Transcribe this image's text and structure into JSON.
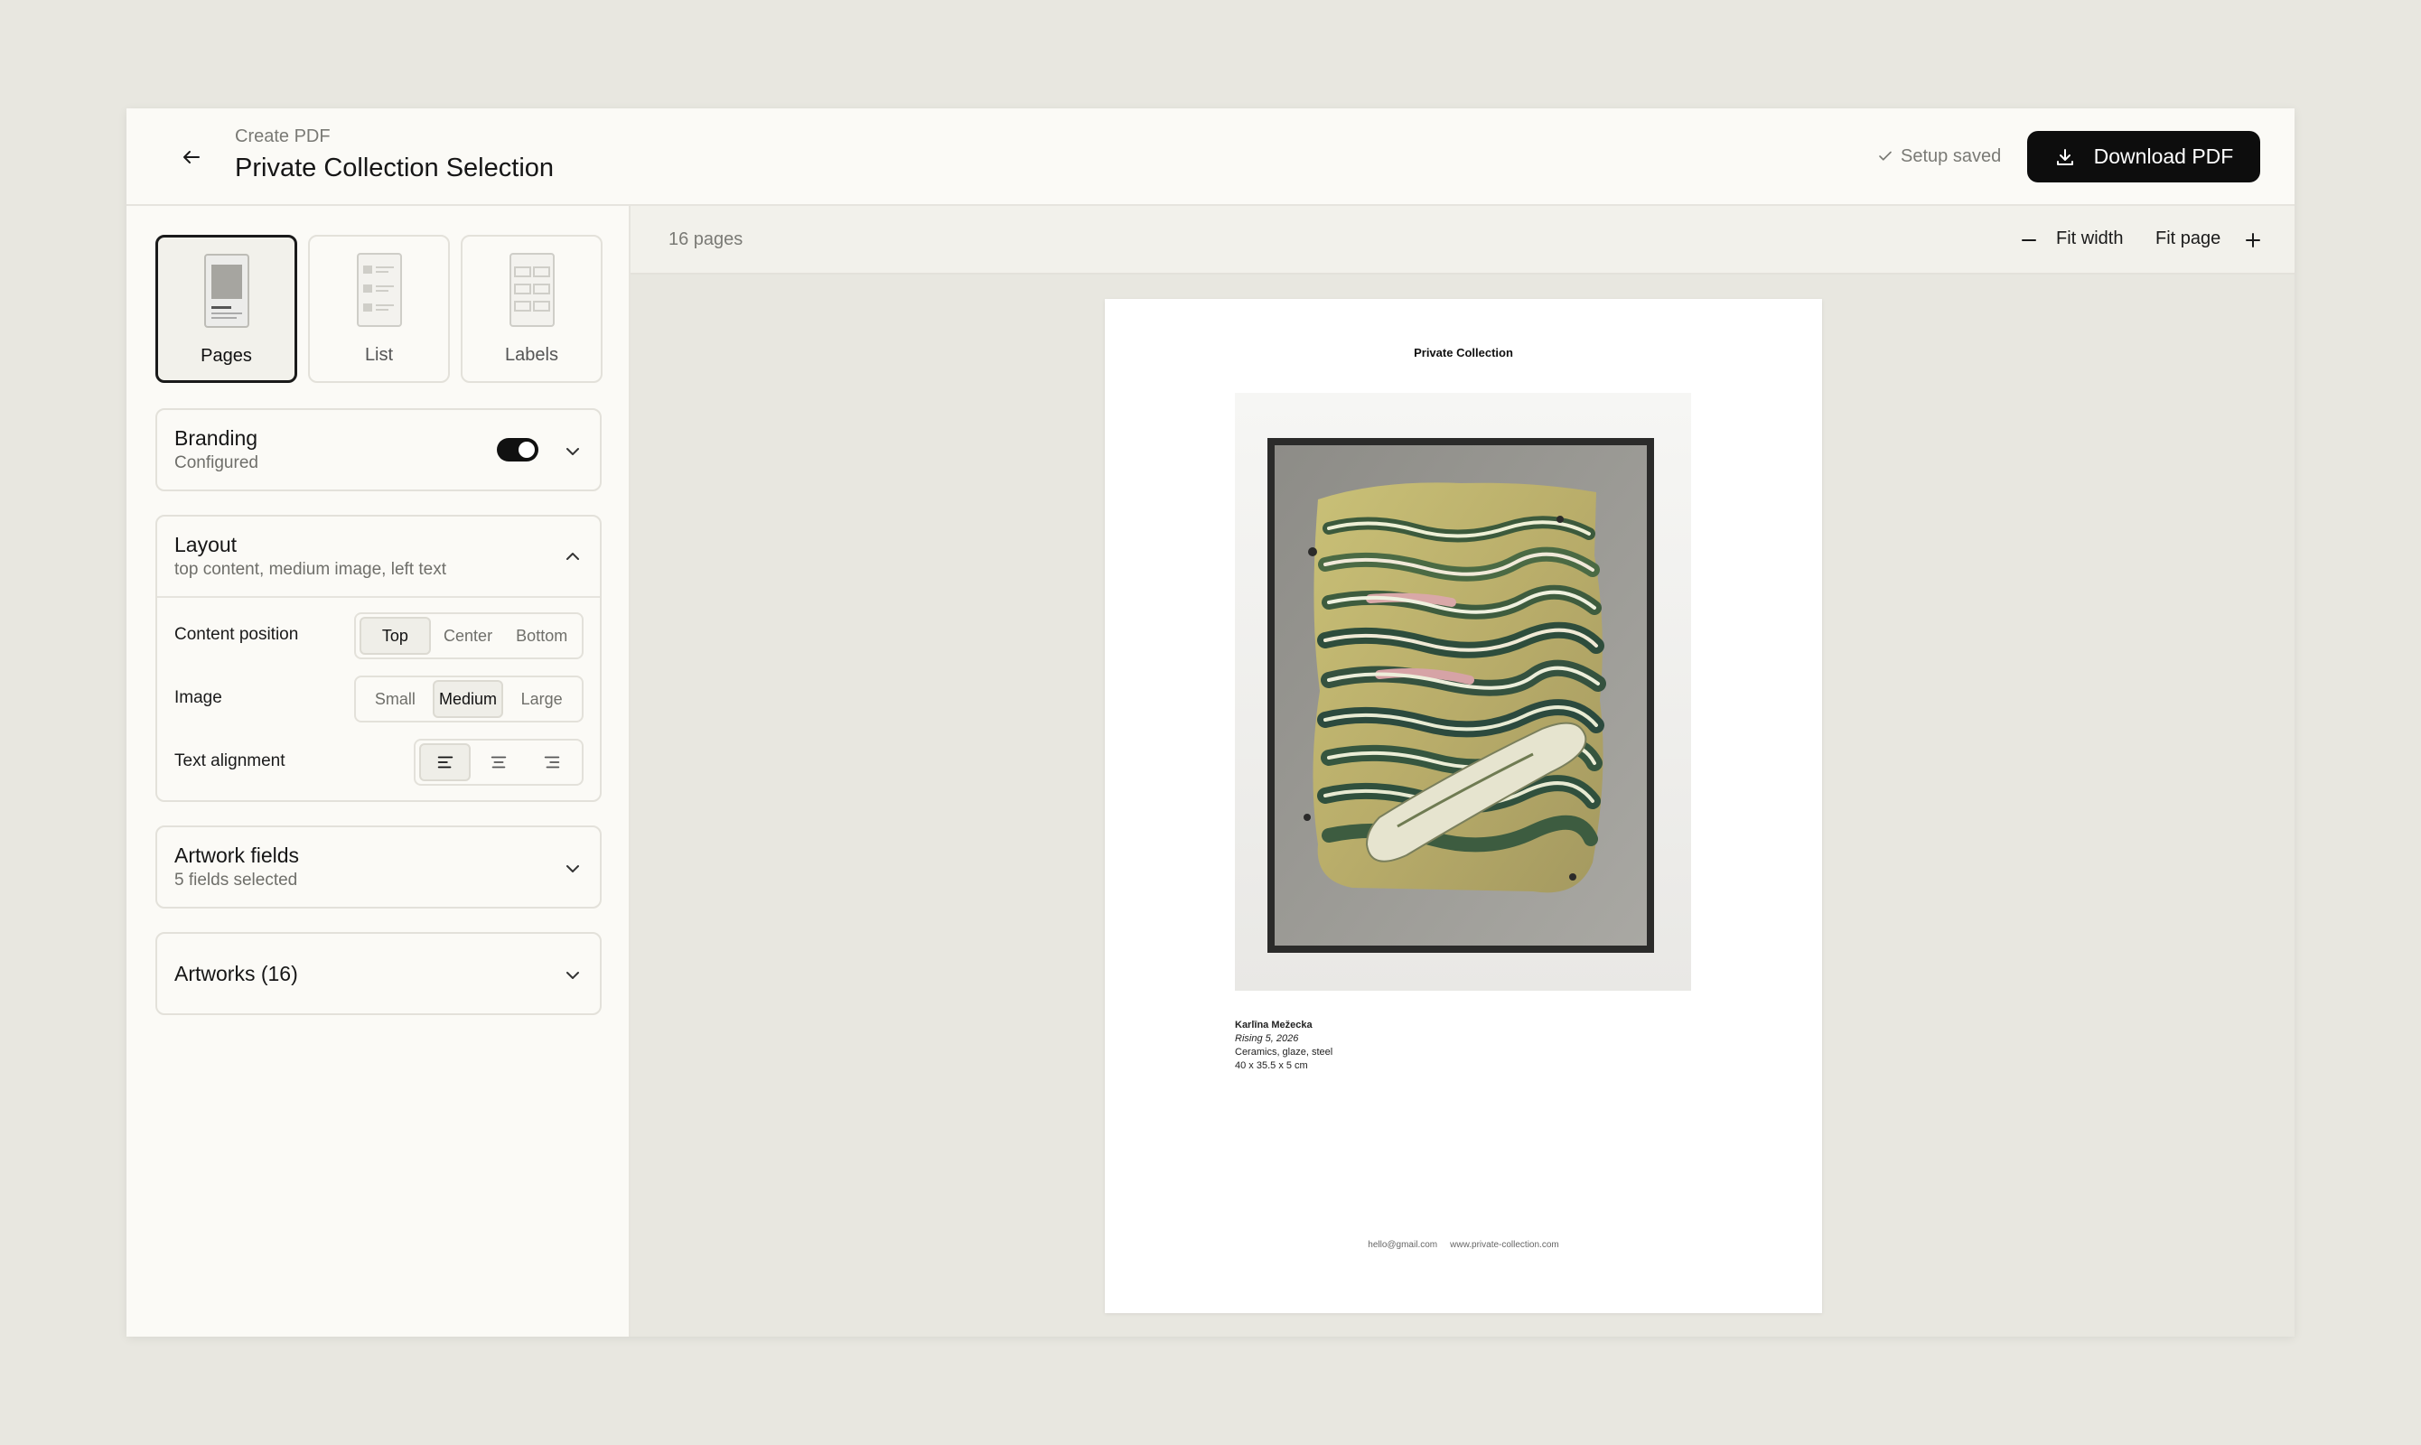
{
  "header": {
    "breadcrumb": "Create PDF",
    "title": "Private Collection Selection",
    "status": "Setup saved",
    "download_label": "Download PDF"
  },
  "modes": [
    {
      "label": "Pages",
      "active": true
    },
    {
      "label": "List",
      "active": false
    },
    {
      "label": "Labels",
      "active": false
    }
  ],
  "branding": {
    "title": "Branding",
    "subtitle": "Configured",
    "enabled": true
  },
  "layout": {
    "title": "Layout",
    "subtitle": "top content, medium image, left text",
    "content_position": {
      "label": "Content position",
      "options": [
        "Top",
        "Center",
        "Bottom"
      ],
      "selected": "Top"
    },
    "image": {
      "label": "Image",
      "options": [
        "Small",
        "Medium",
        "Large"
      ],
      "selected": "Medium"
    },
    "text_alignment": {
      "label": "Text alignment",
      "options": [
        "align-left-icon",
        "align-center-icon",
        "align-right-icon"
      ],
      "selected": "align-left-icon"
    }
  },
  "artwork_fields": {
    "title": "Artwork fields",
    "subtitle": "5 fields selected"
  },
  "artworks": {
    "title": "Artworks (16)"
  },
  "toolbar": {
    "page_count": "16 pages",
    "fit_width": "Fit width",
    "fit_page": "Fit page"
  },
  "preview": {
    "heading": "Private Collection",
    "artist": "Karlīna Mežecka",
    "work_title": "Rising 5, 2026",
    "medium": "Ceramics, glaze, steel",
    "dimensions": "40 x 35.5 x 5 cm",
    "footer_email": "hello@gmail.com",
    "footer_web": "www.private-collection.com"
  },
  "colors": {
    "background": "#e8e7e0",
    "panel": "#fbfaf6",
    "accent": "#0d0d0d"
  }
}
